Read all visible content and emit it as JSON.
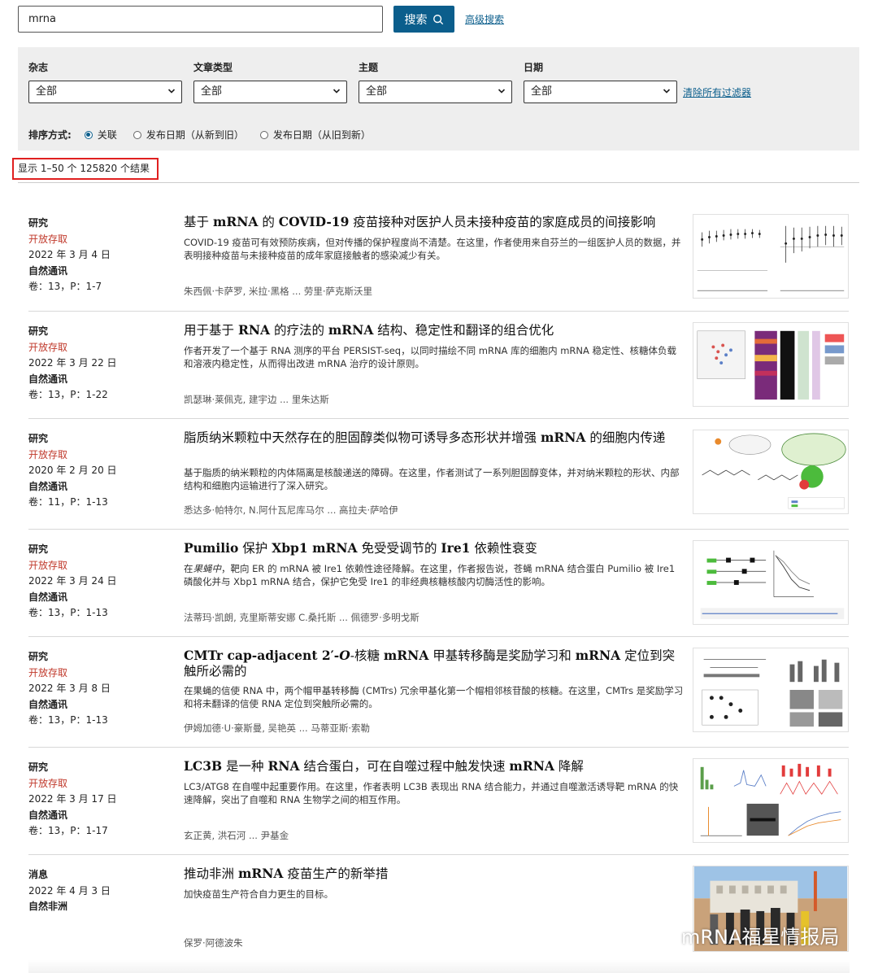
{
  "search": {
    "value": "mrna",
    "button_label": "搜索",
    "advanced_label": "高级搜索"
  },
  "filters": [
    {
      "label": "杂志",
      "value": "全部"
    },
    {
      "label": "文章类型",
      "value": "全部"
    },
    {
      "label": "主题",
      "value": "全部"
    },
    {
      "label": "日期",
      "value": "全部"
    }
  ],
  "clear_label": "清除所有过滤器",
  "sort": {
    "label": "排序方式:",
    "options": [
      {
        "label": "关联",
        "checked": true
      },
      {
        "label": "发布日期（从新到旧）",
        "checked": false
      },
      {
        "label": "发布日期（从旧到新）",
        "checked": false
      }
    ]
  },
  "result_count": "显示 1–50 个 125820 个结果",
  "articles": [
    {
      "type": "研究",
      "open_access": "开放存取",
      "date": "2022 年 3 月 4 日",
      "journal": "自然通讯",
      "volume": "卷：13，P：1-7",
      "title_parts": [
        "基于 ",
        "mRNA",
        " 的 ",
        "COVID-19",
        " 疫苗接种对医护人员未接种疫苗的家庭成员的间接影响"
      ],
      "description": "COVID-19 疫苗可有效预防疾病，但对传播的保护程度尚不清楚。在这里，作者使用来自芬兰的一组医护人员的数据，并表明接种疫苗与未接种疫苗的成年家庭接触者的感染减少有关。",
      "authors": "朱西佩·卡萨罗, 米拉·黑格 ... 劳里·萨克斯沃里"
    },
    {
      "type": "研究",
      "open_access": "开放存取",
      "date": "2022 年 3 月 22 日",
      "journal": "自然通讯",
      "volume": "卷：13，P：1-22",
      "title_parts": [
        "用于基于 ",
        "RNA",
        " 的疗法的 ",
        "mRNA",
        " 结构、稳定性和翻译的组合优化"
      ],
      "description": "作者开发了一个基于 RNA 测序的平台 PERSIST-seq，以同时描绘不同 mRNA 库的细胞内 mRNA 稳定性、核糖体负载和溶液内稳定性，从而得出改进 mRNA 治疗的设计原则。",
      "authors": "凯瑟琳·莱佩克, 建宇边 ... 里朱达斯"
    },
    {
      "type": "研究",
      "open_access": "开放存取",
      "date": "2020 年 2 月 20 日",
      "journal": "自然通讯",
      "volume": "卷：11，P：1-13",
      "title_parts": [
        "脂质纳米颗粒中天然存在的胆固醇类似物可诱导多态形状并增强 ",
        "mRNA",
        " 的细胞内传递"
      ],
      "description": "基于脂质的纳米颗粒的内体隔离是核酸递送的障碍。在这里，作者测试了一系列胆固醇变体，并对纳米颗粒的形状、内部结构和细胞内运输进行了深入研究。",
      "authors": "悉达多·帕特尔, N.阿什瓦尼库马尔 ... 高拉夫·萨哈伊"
    },
    {
      "type": "研究",
      "open_access": "开放存取",
      "date": "2022 年 3 月 24 日",
      "journal": "自然通讯",
      "volume": "卷：13，P：1-13",
      "title_parts": [
        "",
        "Pumilio",
        " 保护 ",
        "Xbp1 mRNA",
        " 免受受调节的 ",
        "Ire1",
        " 依赖性衰变"
      ],
      "description_prefix": "在",
      "description_em": "果蝇中",
      "description": "，靶向 ER 的 mRNA 被 Ire1 依赖性途径降解。在这里，作者报告说，苍蝇 mRNA 结合蛋白 Pumilio 被 Ire1 磷酸化并与 Xbp1 mRNA 结合，保护它免受 Ire1 的非经典核糖核酸内切酶活性的影响。",
      "authors": "法蒂玛·凯朗, 克里斯蒂安娜 C.桑托斯 ... 佩德罗·多明戈斯"
    },
    {
      "type": "研究",
      "open_access": "开放存取",
      "date": "2022 年 3 月 8 日",
      "journal": "自然通讯",
      "volume": "卷：13，P：1-13",
      "title_parts": [
        "",
        "CMTr cap-adjacent 2′-",
        "",
        "O",
        "-核糖 ",
        "mRNA",
        " 甲基转移酶是奖励学习和 ",
        "mRNA",
        " 定位到突触所必需的"
      ],
      "description": "在果蝇的信使 RNA 中，两个帽甲基转移酶 (CMTrs) 冗余甲基化第一个帽相邻核苷酸的核糖。在这里，CMTrs 是奖励学习和将未翻译的信使 RNA 定位到突触所必需的。",
      "authors": "伊姆加德·U·豪斯曼, 吴艳英 ... 马蒂亚斯·索勒"
    },
    {
      "type": "研究",
      "open_access": "开放存取",
      "date": "2022 年 3 月 17 日",
      "journal": "自然通讯",
      "volume": "卷：13，P：1-17",
      "title_parts": [
        "",
        "LC3B",
        " 是一种 ",
        "RNA",
        " 结合蛋白，可在自噬过程中触发快速 ",
        "mRNA",
        " 降解"
      ],
      "description": "LC3/ATG8 在自噬中起重要作用。在这里，作者表明 LC3B 表现出 RNA 结合能力，并通过自噬激活诱导靶 mRNA 的快速降解，突出了自噬和 RNA 生物学之间的相互作用。",
      "authors": "玄正黄, 洪石河 ... 尹基金"
    },
    {
      "type": "消息",
      "date": "2022 年 4 月 3 日",
      "journal": "自然非洲",
      "title_parts": [
        "推动非洲 ",
        "mRNA",
        " 疫苗生产的新举措"
      ],
      "description": "加快疫苗生产符合自力更生的目标。",
      "authors": "保罗·阿德波朱"
    }
  ],
  "watermark": "mRNA福星情报局",
  "colors": {
    "accent": "#0b5e8c",
    "open_access": "#c0392b",
    "highlight_box": "#e02020",
    "panel_bg": "#eeeeee"
  }
}
